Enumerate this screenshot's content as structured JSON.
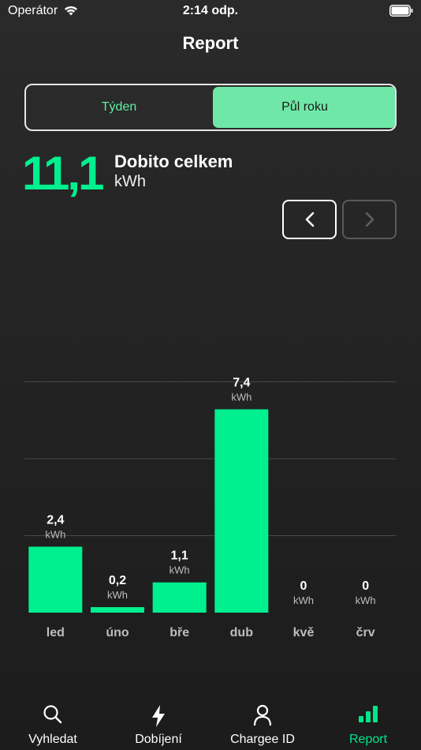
{
  "status_bar": {
    "carrier": "Operátor",
    "time": "2:14 odp."
  },
  "header": {
    "title": "Report"
  },
  "segmented": {
    "week_label": "Týden",
    "half_year_label": "Půl roku",
    "selected": "half_year"
  },
  "summary": {
    "total_value": "11,1",
    "title": "Dobito celkem",
    "unit": "kWh"
  },
  "colors": {
    "accent": "#00f08f",
    "segment_selected": "#6fe8a7",
    "background": "#252525"
  },
  "chart_data": {
    "type": "bar",
    "categories": [
      "led",
      "úno",
      "bře",
      "dub",
      "kvě",
      "črv"
    ],
    "values": [
      2.4,
      0.2,
      1.1,
      7.4,
      0,
      0
    ],
    "value_labels": [
      "2,4",
      "0,2",
      "1,1",
      "7,4",
      "0",
      "0"
    ],
    "unit_label": "kWh",
    "ylim": [
      0,
      10
    ],
    "grid": true,
    "gridlines": [
      2.8,
      5.6,
      8.4
    ]
  },
  "tabbar": {
    "items": [
      {
        "label": "Vyhledat",
        "icon": "search-icon"
      },
      {
        "label": "Dobíjení",
        "icon": "lightning-icon"
      },
      {
        "label": "Chargee ID",
        "icon": "person-icon"
      },
      {
        "label": "Report",
        "icon": "bar-chart-icon"
      }
    ],
    "active_index": 3
  }
}
